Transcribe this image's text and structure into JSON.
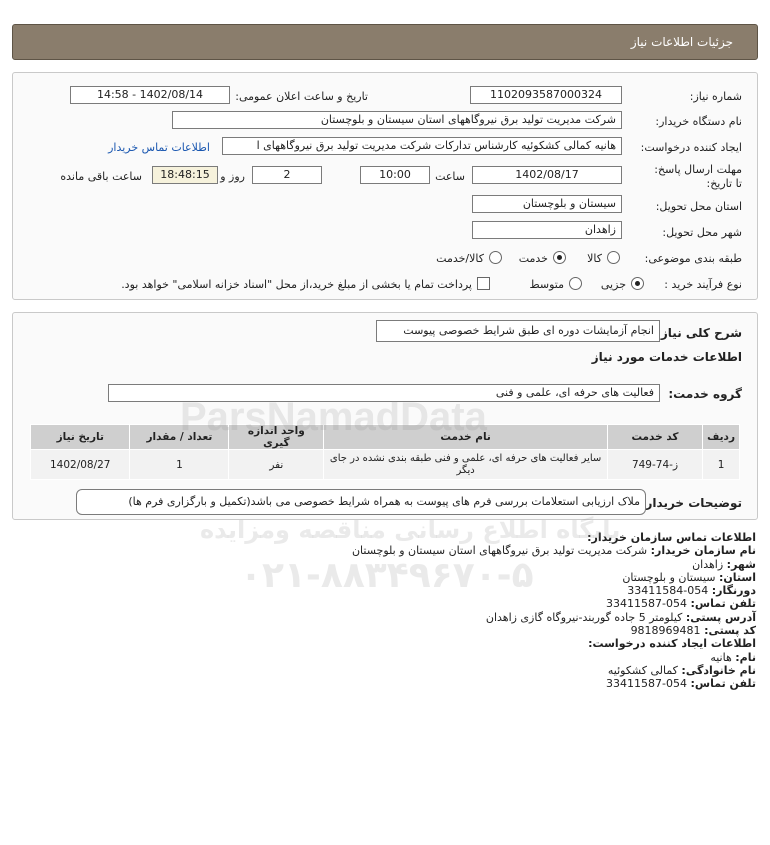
{
  "header": {
    "title": "جزئیات اطلاعات نیاز"
  },
  "form": {
    "need_number_label": "شماره نیاز:",
    "need_number": "1102093587000324",
    "announce_label": "تاریخ و ساعت اعلان عمومی:",
    "announce_value": "1402/08/14 - 14:58",
    "buyer_label": "نام دستگاه خریدار:",
    "buyer_value": "شرکت مدیریت تولید برق نیروگاههای استان سیستان و بلوچستان",
    "creator_label": "ایجاد کننده درخواست:",
    "creator_value": "هانیه کمالی کشکوئیه کارشناس تدارکات شرکت مدیریت تولید برق نیروگاههای ا",
    "contact_link": "اطلاعات تماس خریدار",
    "deadline_label": "مهلت ارسال پاسخ: تا تاریخ:",
    "deadline_date": "1402/08/17",
    "time_label": "ساعت",
    "deadline_time": "10:00",
    "days_value": "2",
    "days_label": "روز و",
    "remaining_time": "18:48:15",
    "remaining_label": "ساعت باقی مانده",
    "province_label": "استان محل تحویل:",
    "province_value": "سیستان و بلوچستان",
    "city_label": "شهر محل تحویل:",
    "city_value": "زاهدان",
    "category_label": "طبقه بندی موضوعی:",
    "category_options": [
      "کالا",
      "خدمت",
      "کالا/خدمت"
    ],
    "process_label": "نوع فرآیند خرید :",
    "process_options": [
      "جزیی",
      "متوسط"
    ],
    "payment_text": "پرداخت تمام یا بخشی از مبلغ خرید،از محل \"اسناد خزانه اسلامی\" خواهد بود."
  },
  "details": {
    "summary_label": "شرح کلی نیاز:",
    "summary_value": "انجام آزمایشات دوره ای طبق شرایط خصوصی پیوست",
    "services_title": "اطلاعات خدمات مورد نیاز",
    "group_label": "گروه خدمت:",
    "group_value": "فعالیت های حرفه ای، علمی و فنی",
    "table_headers": [
      "ردیف",
      "کد خدمت",
      "نام خدمت",
      "واحد اندازه گیری",
      "تعداد / مقدار",
      "تاریخ نیاز"
    ],
    "table_rows": [
      [
        "1",
        "ز-74-749",
        "سایر فعالیت های حرفه ای، علمی و فنی طبقه بندی نشده در جای دیگر",
        "نفر",
        "1",
        "1402/08/27"
      ]
    ],
    "notes_label": "توضیحات خریدار:",
    "notes_value": "ملاک ارزیابی استعلامات بررسی فرم های پیوست به همراه شرایط خصوصی می باشد(تکمیل و بارگزاری فرم ها)"
  },
  "contact": {
    "title": "اطلاعات تماس سازمان خریدار:",
    "org_label": "نام سازمان خریدار:",
    "org_value": "شرکت مدیریت تولید برق نیروگاههای استان سیستان و بلوچستان",
    "city_label": "شهر:",
    "city_value": "زاهدان",
    "province_label": "استان:",
    "province_value": "سیستان و بلوچستان",
    "fax_label": "دورنگار:",
    "fax_value": "054-33411584",
    "phone_label": "تلفن تماس:",
    "phone_value": "054-33411587",
    "address_label": "آدرس پستی:",
    "address_value": "کیلومتر 5 جاده گوربند-نیروگاه گازی زاهدان",
    "postal_label": "کد پستی:",
    "postal_value": "9818969481",
    "creator_title": "اطلاعات ایجاد کننده درخواست:",
    "name_label": "نام:",
    "name_value": "هانیه",
    "family_label": "نام خانوادگی:",
    "family_value": "کمالی کشکوئیه",
    "creator_phone_label": "تلفن تماس:",
    "creator_phone_value": "054-33411587"
  },
  "watermark": {
    "site": "ParsNamadData",
    "tagline": "پایگاه اطلاع رسانی مناقصه ومزایده",
    "phone": "۰۲۱-۸۸۳۴۹۶۷۰-۵"
  }
}
